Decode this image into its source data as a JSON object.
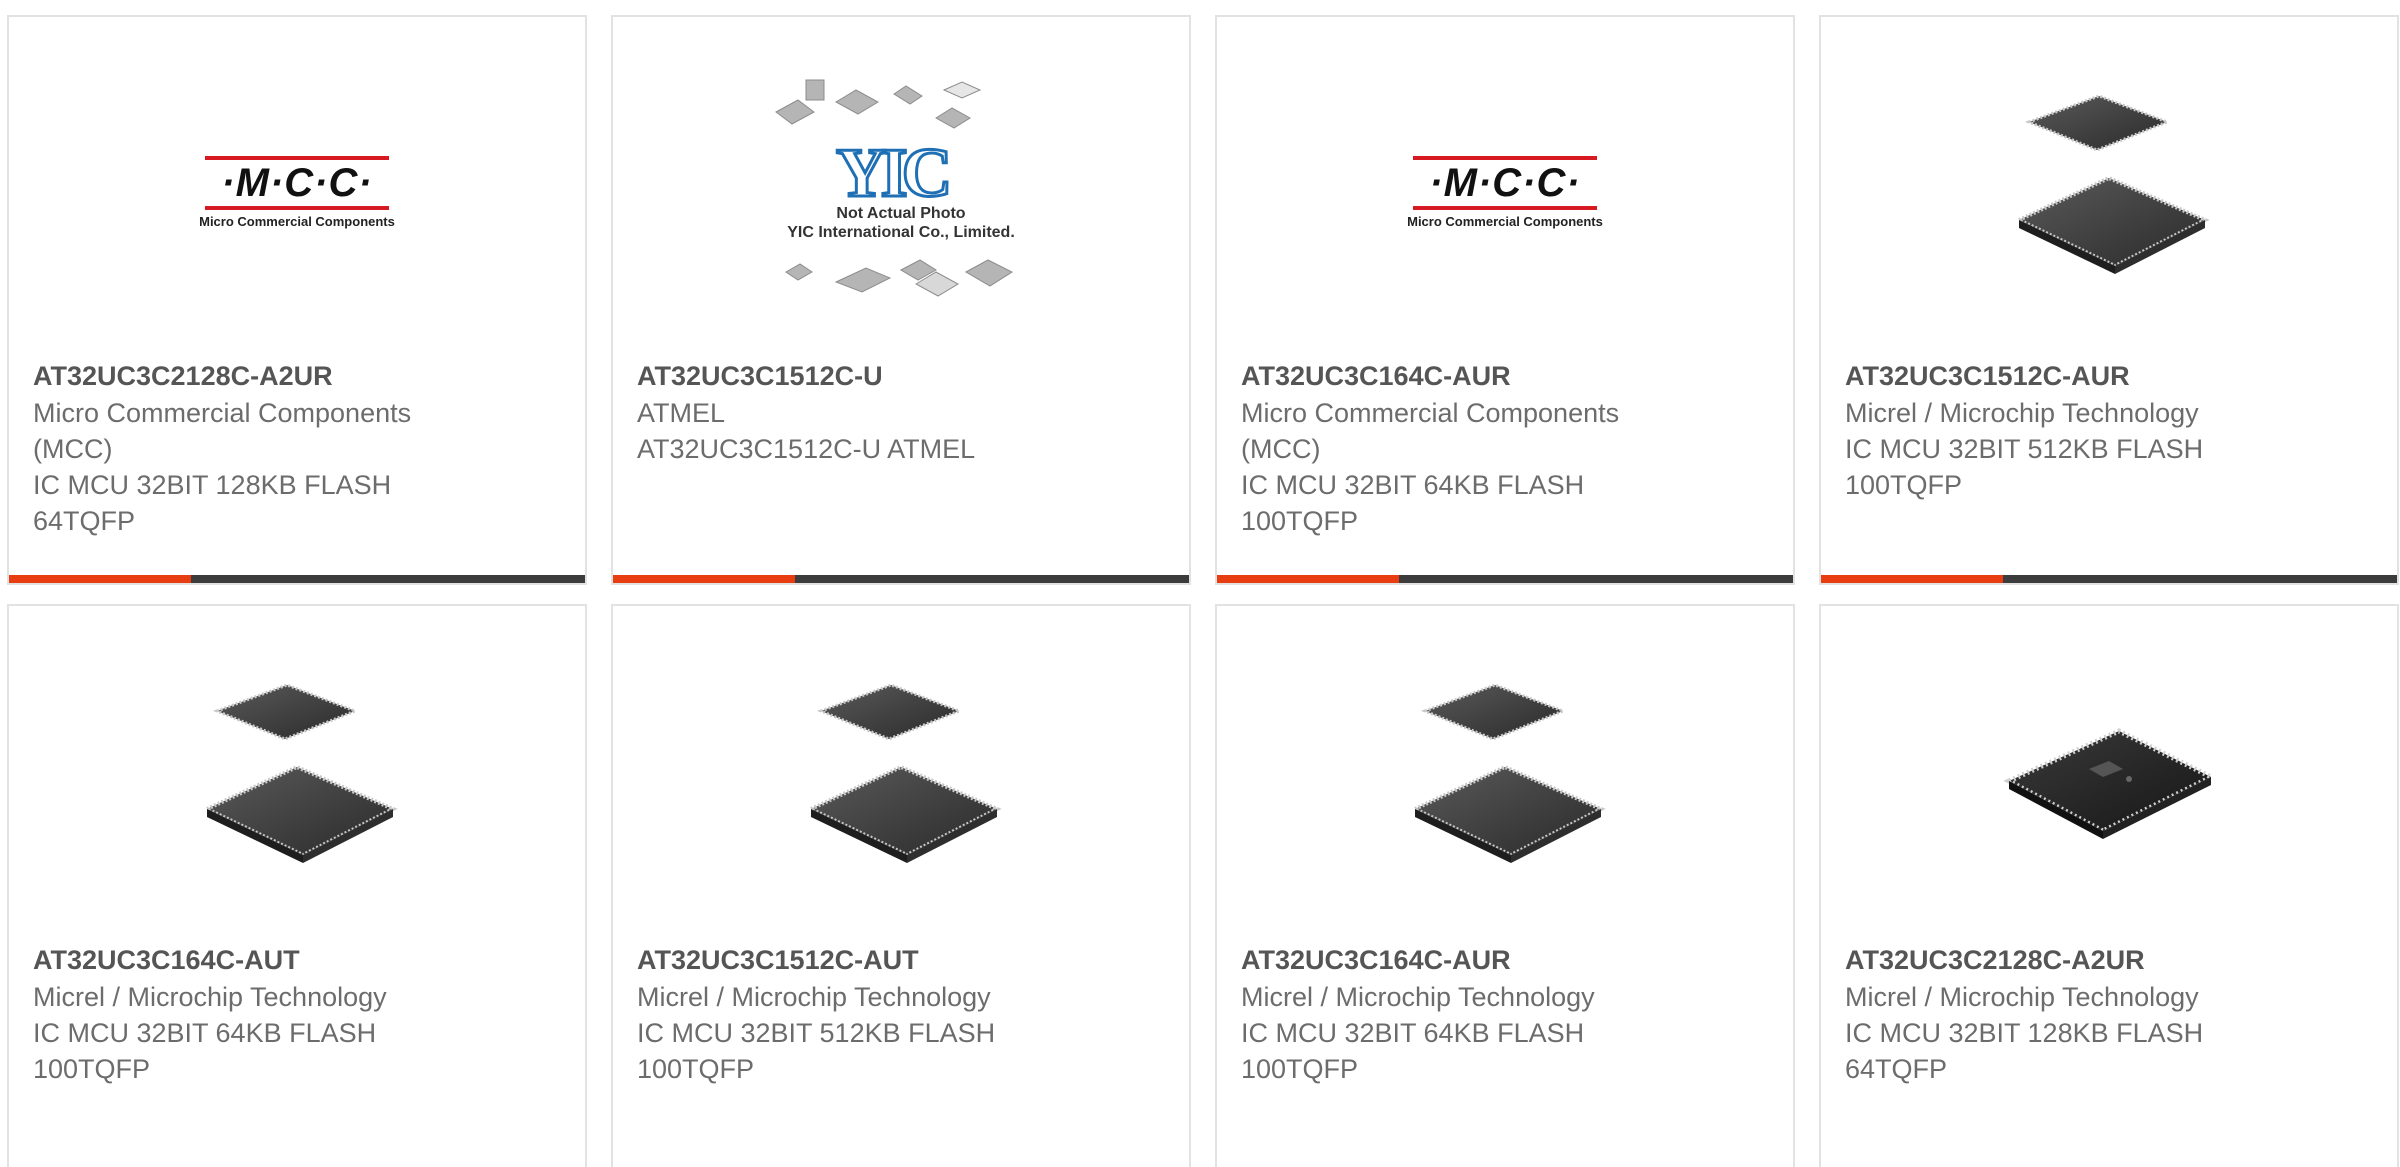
{
  "colors": {
    "accent": "#e83d10",
    "bar": "#3c3c3c",
    "border": "#e2e2e2",
    "part_text": "#555555",
    "desc_text": "#6c6c6c",
    "mcc_red": "#d71921",
    "yic_blue": "#1f6fb5"
  },
  "images": {
    "mcc_logo_text": "·M·C·C·",
    "mcc_logo_sub": "Micro Commercial Components",
    "yic_mark": "YIC",
    "yic_caption_1": "Not Actual Photo",
    "yic_caption_2": "YIC International Co., Limited."
  },
  "products": [
    {
      "part": "AT32UC3C2128C-A2UR",
      "manufacturer": "Micro Commercial Components (MCC)",
      "description": "IC MCU 32BIT 128KB FLASH 64TQFP",
      "image": "mcc-logo"
    },
    {
      "part": "AT32UC3C1512C-U",
      "manufacturer": "ATMEL",
      "description": "AT32UC3C1512C-U ATMEL",
      "image": "yic-placeholder"
    },
    {
      "part": "AT32UC3C164C-AUR",
      "manufacturer": "Micro Commercial Components (MCC)",
      "description": "IC MCU 32BIT 64KB FLASH 100TQFP",
      "image": "mcc-logo"
    },
    {
      "part": "AT32UC3C1512C-AUR",
      "manufacturer": "Micrel / Microchip Technology",
      "description": "IC MCU 32BIT 512KB FLASH 100TQFP",
      "image": "tqfp-chip"
    },
    {
      "part": "AT32UC3C164C-AUT",
      "manufacturer": "Micrel / Microchip Technology",
      "description": "IC MCU 32BIT 64KB FLASH 100TQFP",
      "image": "tqfp-chip"
    },
    {
      "part": "AT32UC3C1512C-AUT",
      "manufacturer": "Micrel / Microchip Technology",
      "description": "IC MCU 32BIT 512KB FLASH 100TQFP",
      "image": "tqfp-chip"
    },
    {
      "part": "AT32UC3C164C-AUR",
      "manufacturer": "Micrel / Microchip Technology",
      "description": "IC MCU 32BIT 64KB FLASH 100TQFP",
      "image": "tqfp-chip"
    },
    {
      "part": "AT32UC3C2128C-A2UR",
      "manufacturer": "Micrel / Microchip Technology",
      "description": "IC MCU 32BIT 128KB FLASH 64TQFP",
      "image": "tqfp64-chip"
    }
  ]
}
